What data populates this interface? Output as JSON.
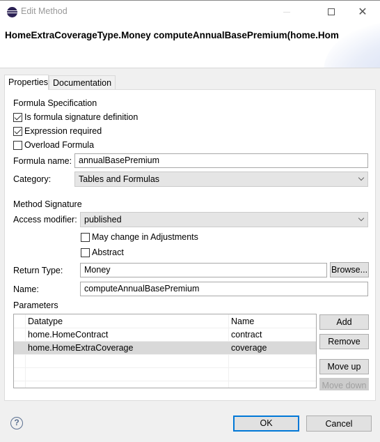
{
  "window": {
    "title": "Edit Method",
    "icon": "eclipse-icon",
    "controls": {
      "minimize": "minimize-icon",
      "maximize": "maximize-icon",
      "close": "close-icon"
    },
    "close_glyph": "✕"
  },
  "header": {
    "title": "HomeExtraCoverageType.Money computeAnnualBasePremium(home.HomeContract, home.HomeExtraCoverage)"
  },
  "tabs": [
    {
      "label": "Properties",
      "active": true
    },
    {
      "label": "Documentation",
      "active": false
    }
  ],
  "formula_spec": {
    "section_label": "Formula Specification",
    "checkboxes": [
      {
        "label": "Is formula signature definition",
        "checked": true
      },
      {
        "label": "Expression required",
        "checked": true
      },
      {
        "label": "Overload Formula",
        "checked": false
      }
    ],
    "formula_name_label": "Formula name:",
    "formula_name_value": "annualBasePremium",
    "category_label": "Category:",
    "category_value": "Tables and Formulas"
  },
  "method_signature": {
    "section_label": "Method Signature",
    "access_modifier_label": "Access modifier:",
    "access_modifier_value": "published",
    "checkboxes": [
      {
        "label": "May change in Adjustments",
        "checked": false
      },
      {
        "label": "Abstract",
        "checked": false
      }
    ],
    "return_type_label": "Return Type:",
    "return_type_value": "Money",
    "browse_label": "Browse...",
    "name_label": "Name:",
    "name_value": "computeAnnualBasePremium"
  },
  "parameters": {
    "section_label": "Parameters",
    "columns": [
      "Datatype",
      "Name"
    ],
    "rows": [
      {
        "datatype": "home.HomeContract",
        "name": "contract",
        "selected": false
      },
      {
        "datatype": "home.HomeExtraCoverage",
        "name": "coverage",
        "selected": true
      }
    ],
    "buttons": {
      "add": "Add",
      "remove": "Remove",
      "move_up": "Move up",
      "move_down": "Move down"
    }
  },
  "footer": {
    "help_glyph": "?",
    "ok_label": "OK",
    "cancel_label": "Cancel"
  }
}
